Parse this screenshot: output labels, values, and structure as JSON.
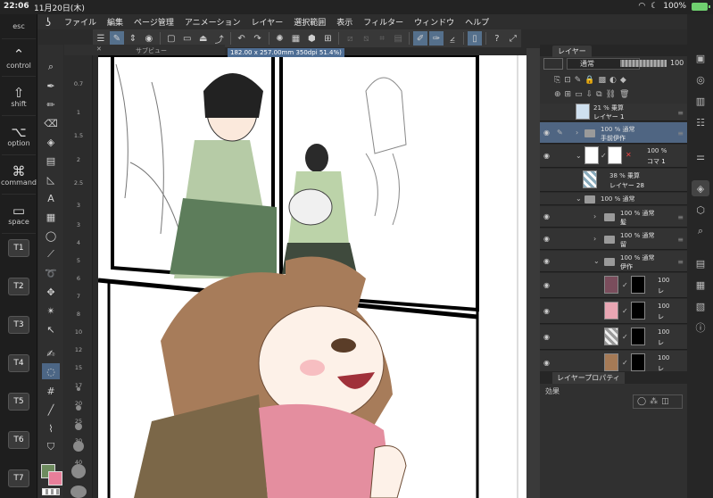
{
  "status": {
    "time": "22:06",
    "date": "11月20日(木)",
    "battery": "100%"
  },
  "keys": {
    "esc": "esc",
    "control": "control",
    "shift": "shift",
    "option": "option",
    "command": "command",
    "space": "space",
    "t": [
      "T1",
      "T2",
      "T3",
      "T4",
      "T5",
      "T6",
      "T7"
    ]
  },
  "menu": [
    "ファイル",
    "編集",
    "ページ管理",
    "アニメーション",
    "レイヤー",
    "選択範囲",
    "表示",
    "フィルター",
    "ウィンドウ",
    "ヘルプ"
  ],
  "subview_label": "サブビュー",
  "canvas_info": "182.00 x 257.00mm 350dpi 51.4%)",
  "ruler_marks": [
    "0.7",
    "1",
    "1.5",
    "2",
    "2.5",
    "3"
  ],
  "brush_sizes": [
    "3",
    "4",
    "5",
    "6",
    "7",
    "8",
    "10",
    "12",
    "15",
    "17",
    "20",
    "25",
    "30",
    "40"
  ],
  "layer_panel": {
    "tab": "レイヤー",
    "blend_mode": "通常",
    "opacity": "100",
    "layers": [
      {
        "line1": "21 % 乗算",
        "line2": "レイヤー 1"
      },
      {
        "line1": "100 % 通常",
        "line2": "手前伊作"
      },
      {
        "line1": "100 %",
        "line2": "コマ 1"
      },
      {
        "line1": "38 % 乗算",
        "line2": "レイヤー 28"
      },
      {
        "line1": "100 % 通常",
        "line2": ""
      },
      {
        "line1": "100 % 通常",
        "line2": "髪"
      },
      {
        "line1": "100 % 通常",
        "line2": "留"
      },
      {
        "line1": "100 % 通常",
        "line2": "伊作"
      },
      {
        "line1": "100",
        "line2": "レ"
      },
      {
        "line1": "100",
        "line2": "レ"
      },
      {
        "line1": "100",
        "line2": "レ"
      },
      {
        "line1": "100",
        "line2": "レ"
      }
    ]
  },
  "property_panel": {
    "tab": "レイヤープロパティ",
    "effect_label": "効果"
  },
  "colors": {
    "accent": "#4f6582",
    "main_swatch": "#6d8b5e",
    "sub_swatch": "#e77f9a"
  }
}
